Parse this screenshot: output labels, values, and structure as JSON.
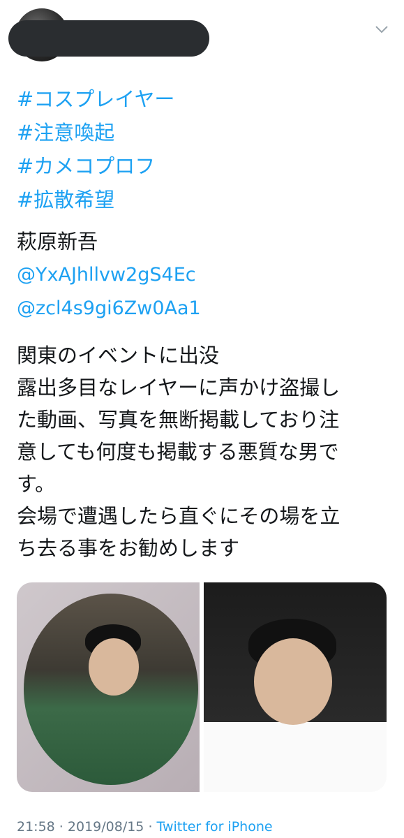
{
  "tweet": {
    "hashtags": [
      "#コスプレイヤー",
      "#注意喚起",
      "#カメコプロフ",
      "#拡散希望"
    ],
    "name": "萩原新吾",
    "mentions": [
      "@YxAJhllvw2gS4Ec",
      "@zcl4s9gi6Zw0Aa1"
    ],
    "description_lines": [
      "関東のイベントに出没",
      "露出多目なレイヤーに声かけ盗撮し",
      "た動画、写真を無断掲載しており注",
      "意しても何度も掲載する悪質な男で",
      "す。",
      "会場で遭遇したら直ぐにその場を立",
      "ち去る事をお勧めします"
    ],
    "time": "21:58",
    "separator1": " · ",
    "date": "2019/08/15",
    "separator2": " · ",
    "source": "Twitter for iPhone"
  },
  "icons": {
    "caret": "chevron-down-icon"
  },
  "colors": {
    "link": "#1da1f2",
    "text": "#14171a",
    "meta": "#657786"
  }
}
